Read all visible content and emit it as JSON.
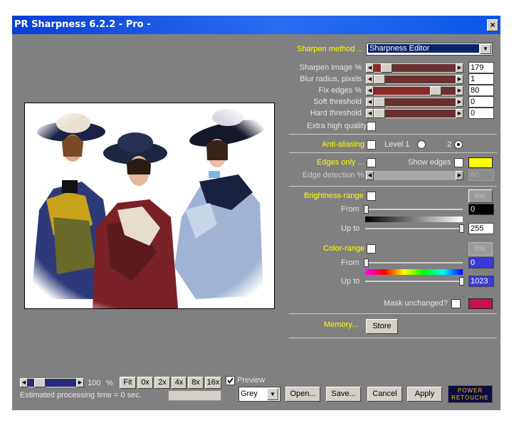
{
  "window": {
    "title": "PR Sharpness 6.2.2 - Pro -",
    "close_label": "×"
  },
  "sharpen": {
    "method_label": "Sharpen method ...",
    "method_value": "Sharpness Editor",
    "sliders": [
      {
        "label": "Sharpen image %",
        "value": "179",
        "level": 0.1
      },
      {
        "label": "Blur radius, pixels",
        "value": "1",
        "level": 0.0
      },
      {
        "label": "Fix edges %",
        "value": "80",
        "level": 0.8
      },
      {
        "label": "Soft threshold",
        "value": "0",
        "level": 0.0
      },
      {
        "label": "Hard threshold",
        "value": "0",
        "level": 0.0
      }
    ],
    "extra_quality_label": "Extra high quality"
  },
  "antialias": {
    "label": "Anti-aliasing",
    "level1_label": "Level 1",
    "level2_label": "2"
  },
  "edges": {
    "edges_only_label": "Edges only ...",
    "show_edges_label": "Show edges",
    "detection_label": "Edge detection %",
    "detection_value": "80",
    "edge_color": "#ffff00"
  },
  "brightness": {
    "label": "Brightness-range",
    "inv_label": "Inv.",
    "from_label": "From",
    "from_value": "0",
    "upto_label": "Up to",
    "upto_value": "255"
  },
  "color": {
    "label": "Color-range",
    "inv_label": "Inv.",
    "from_label": "From",
    "from_value": "0",
    "upto_label": "Up to",
    "upto_value": "1023"
  },
  "mask": {
    "label": "Mask unchanged?",
    "color": "#c8104a"
  },
  "memory": {
    "label": "Memory...",
    "store_label": "Store"
  },
  "zoom": {
    "value": "100",
    "unit": "%",
    "buttons": [
      "Fit",
      "0x",
      "2x",
      "4x",
      "8x",
      "16x"
    ]
  },
  "preview_label": "Preview",
  "estimate": "Estimated processing time =   0 sec.",
  "mode": {
    "value": "Grey"
  },
  "actions": {
    "open": "Open...",
    "save": "Save...",
    "cancel": "Cancel",
    "apply": "Apply"
  },
  "logo": {
    "line1": "POWER",
    "line2": "RETOUCHE"
  }
}
